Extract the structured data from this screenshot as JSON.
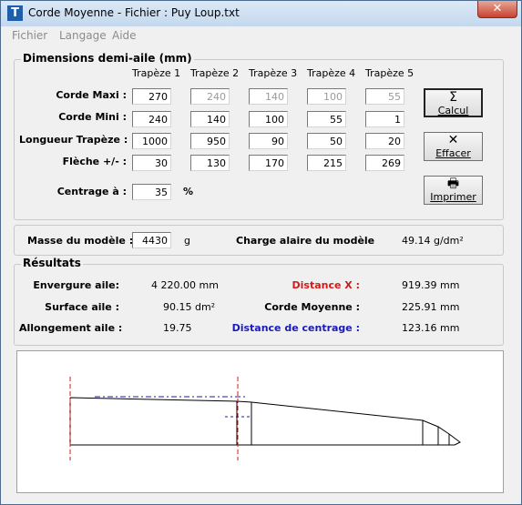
{
  "window": {
    "title": "Corde Moyenne - Fichier : Puy Loup.txt",
    "close_glyph": "✕",
    "app_icon_glyph": "T"
  },
  "menu": [
    "Fichier",
    "Langage",
    "Aide"
  ],
  "dimensions": {
    "title": "Dimensions demi-aile (mm)",
    "headers": [
      "Trapèze 1",
      "Trapèze 2",
      "Trapèze 3",
      "Trapèze 4",
      "Trapèze 5"
    ],
    "rows": [
      {
        "label": "Corde Maxi :",
        "values": [
          "270",
          "240",
          "140",
          "100",
          "55"
        ]
      },
      {
        "label": "Corde Mini :",
        "values": [
          "240",
          "140",
          "100",
          "55",
          "1"
        ]
      },
      {
        "label": "Longueur Trapèze :",
        "values": [
          "1000",
          "950",
          "90",
          "50",
          "20"
        ]
      },
      {
        "label": "Flèche +/- :",
        "values": [
          "30",
          "130",
          "170",
          "215",
          "269"
        ]
      }
    ],
    "centrage": {
      "label": "Centrage à :",
      "value": "35",
      "unit": "%"
    }
  },
  "buttons": {
    "calcul": {
      "icon": "Σ",
      "label": "Calcul"
    },
    "effacer": {
      "icon": "✕",
      "label": "Effacer"
    },
    "imprimer": {
      "icon": "🖶",
      "label": "Imprimer"
    }
  },
  "masse": {
    "label": "Masse du modèle :",
    "value": "4430",
    "unit": "g",
    "charge_label": "Charge alaire du modèle",
    "charge_value": "49.14 g/dm²"
  },
  "resultats": {
    "title": "Résultats",
    "envergure": {
      "label": "Envergure aile:",
      "value": "4 220.00 mm"
    },
    "surface": {
      "label": "Surface aile :",
      "value": "90.15 dm²"
    },
    "allongement": {
      "label": "Allongement aile :",
      "value": "19.75"
    },
    "distance_x": {
      "label": "Distance X :",
      "value": "919.39 mm"
    },
    "corde_moyenne": {
      "label": "Corde Moyenne :",
      "value": "225.91 mm"
    },
    "distance_centrage": {
      "label": "Distance de centrage :",
      "value": "123.16 mm"
    }
  },
  "colors": {
    "distance_x": "#d11a1a",
    "distance_centrage": "#1a1ab8",
    "axis_red": "#d11a1a",
    "axis_blue": "#1a1ab8"
  }
}
